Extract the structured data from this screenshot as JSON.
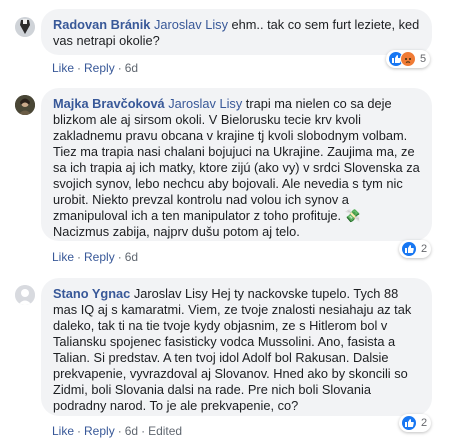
{
  "comments": [
    {
      "author": "Radovan Bránik",
      "mention": "Jaroslav Lisy",
      "text": " ehm.. tak co sem furt leziete, ked vas netrapi okolie?",
      "actions": {
        "like": "Like",
        "reply": "Reply",
        "time": "6d"
      },
      "reaction_count": "5",
      "reaction_icons": [
        "like-reaction-icon",
        "angry-reaction-icon"
      ]
    },
    {
      "author": "Majka Bravčoková",
      "mention": "Jaroslav Lisy",
      "text": " trapi ma nielen co sa deje blizkom ale aj sirsom okoli. V Bielorusku tecie krv kvoli zakladnemu pravu obcana v krajine tj kvoli slobodnym volbam. Tiez ma trapia nasi chalani bojujuci na Ukrajine. Zaujima ma, ze sa ich trapia aj ich matky, ktore zijú (ako vy) v srdci Slovenska za svojich synov, lebo nechcu aby bojovali. Ale nevedia s tym nic urobit. Niekto prevzal kontrolu nad volou ich synov a zmanipuloval ich a ten manipulator z toho profituje. 💸 Nacizmus zabija, najprv dušu potom aj telo.",
      "actions": {
        "like": "Like",
        "reply": "Reply",
        "time": "6d"
      },
      "reaction_count": "2",
      "reaction_icons": [
        "like-reaction-icon"
      ]
    },
    {
      "author": "Stano Ygnac",
      "mention": "",
      "text": " Jaroslav Lisy Hej ty nackovske tupelo. Tych 88 mas IQ aj s kamaratmi. Viem, ze tvoje znalosti nesiahaju az tak daleko, tak ti na tie tvoje kydy objasnim, ze s Hitlerom bol v Taliansku spojenec fasisticky vodca Mussolini. Ano, fasista a Talian. Si predstav. A ten tvoj idol Adolf bol Rakusan. Dalsie prekvapenie, vyvrazdoval aj Slovanov. Hned ako by skoncili so Zidmi, boli Slovania dalsi na rade. Pre nich boli Slovania podradny narod. To je ale prekvapenie, co?",
      "actions": {
        "like": "Like",
        "reply": "Reply",
        "time": "6d",
        "edited": "Edited"
      },
      "reaction_count": "2",
      "reaction_icons": [
        "like-reaction-icon"
      ]
    }
  ]
}
